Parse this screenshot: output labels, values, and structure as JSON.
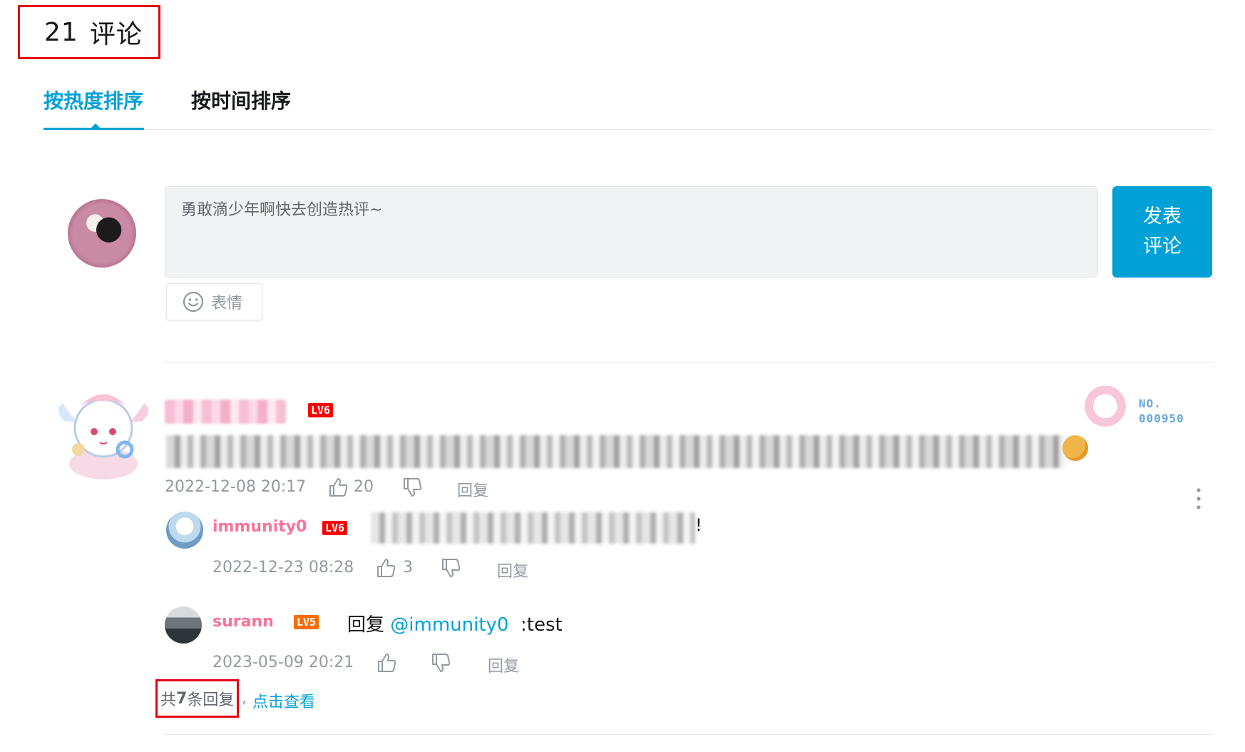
{
  "header": {
    "count": "21",
    "label": "评论"
  },
  "tabs": [
    {
      "label": "按热度排序",
      "active": true
    },
    {
      "label": "按时间排序",
      "active": false
    }
  ],
  "composer": {
    "placeholder": "勇敢滴少年啊快去创造热评~",
    "emoji_label": "表情",
    "submit_line1": "发表",
    "submit_line2": "评论"
  },
  "comment": {
    "level": "LV6",
    "time": "2022-12-08 20:17",
    "likes": "20",
    "reply_label": "回复",
    "fan_no_line1": "NO.",
    "fan_no_line2": "000950"
  },
  "replies": [
    {
      "user": "immunity0",
      "level": "LV6",
      "text_suffix": "!",
      "time": "2022-12-23 08:28",
      "likes": "3",
      "reply_label": "回复"
    },
    {
      "user": "surann",
      "level": "LV5",
      "reply_prefix": "回复",
      "mention": "@immunity0",
      "text": ":test",
      "time": "2023-05-09 20:21",
      "reply_label": "回复"
    }
  ],
  "more_replies": {
    "prefix": "共",
    "count": "7",
    "suffix": "条回复",
    "comma": ",",
    "link": "点击查看"
  },
  "colors": {
    "accent": "#00a1d6",
    "name_pink": "#fb7299",
    "highlight_box": "#e60012",
    "lv6": "#ff0000",
    "lv5": "#ff6c00"
  }
}
